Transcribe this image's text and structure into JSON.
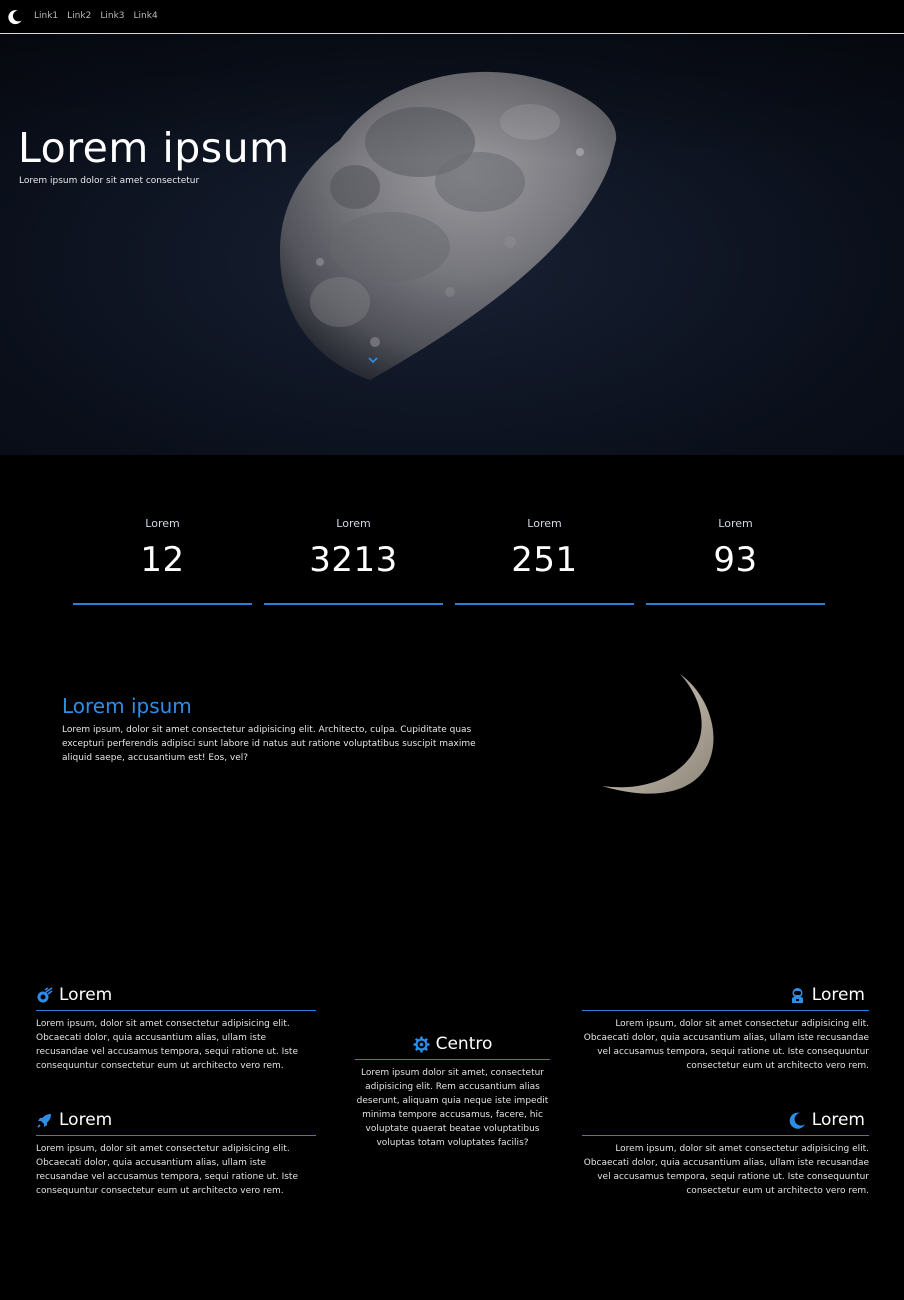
{
  "nav": {
    "logo_icon": "moon-icon",
    "links": [
      "Link1",
      "Link2",
      "Link3",
      "Link4"
    ]
  },
  "hero": {
    "title": "Lorem ipsum",
    "subtitle": "Lorem ipsum dolor sit amet consectetur",
    "scroll_icon": "chevron-down-icon"
  },
  "stats": [
    {
      "label": "Lorem",
      "value": "12"
    },
    {
      "label": "Lorem",
      "value": "3213"
    },
    {
      "label": "Lorem",
      "value": "251"
    },
    {
      "label": "Lorem",
      "value": "93"
    }
  ],
  "about": {
    "title": "Lorem ipsum",
    "text": "Lorem ipsum, dolor sit amet consectetur adipisicing elit. Architecto, culpa. Cupiditate quas excepturi perferendis adipisci sunt labore id natus aut ratione voluptatibus suscipit maxime aliquid saepe, accusantium est! Eos, vel?"
  },
  "features": {
    "top_left": {
      "icon": "meteor-icon",
      "title": "Lorem",
      "text": "Lorem ipsum, dolor sit amet consectetur adipisicing elit. Obcaecati dolor, quia accusantium alias, ullam iste recusandae vel accusamus tempora, sequi ratione ut. Iste consequuntur consectetur eum ut architecto vero rem."
    },
    "bottom_left": {
      "icon": "rocket-icon",
      "title": "Lorem",
      "text": "Lorem ipsum, dolor sit amet consectetur adipisicing elit. Obcaecati dolor, quia accusantium alias, ullam iste recusandae vel accusamus tempora, sequi ratione ut. Iste consequuntur consectetur eum ut architecto vero rem."
    },
    "center": {
      "icon": "gear-icon",
      "title": "Centro",
      "text": "Lorem ipsum dolor sit amet, consectetur adipisicing elit. Rem accusantium alias deserunt, aliquam quia neque iste impedit minima tempore accusamus, facere, hic voluptate quaerat beatae voluptatibus voluptas totam voluptates facilis?"
    },
    "top_right": {
      "icon": "astronaut-icon",
      "title": "Lorem",
      "text": "Lorem ipsum, dolor sit amet consectetur adipisicing elit. Obcaecati dolor, quia accusantium alias, ullam iste recusandae vel accusamus tempora, sequi ratione ut. Iste consequuntur consectetur eum ut architecto vero rem."
    },
    "bottom_right": {
      "icon": "moon-icon",
      "title": "Lorem",
      "text": "Lorem ipsum, dolor sit amet consectetur adipisicing elit. Obcaecati dolor, quia accusantium alias, ullam iste recusandae vel accusamus tempora, sequi ratione ut. Iste consequuntur consectetur eum ut architecto vero rem."
    }
  },
  "colors": {
    "accent": "#2b7fd6",
    "background": "#000000"
  }
}
